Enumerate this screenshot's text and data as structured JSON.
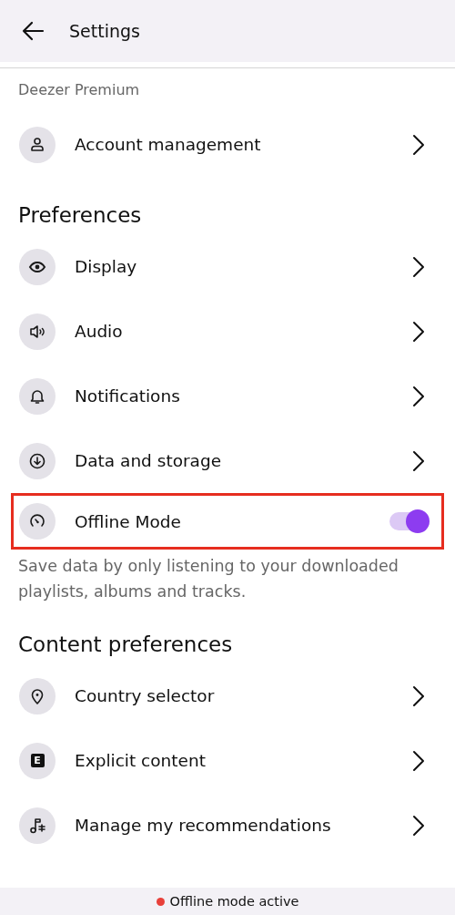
{
  "header": {
    "title": "Settings"
  },
  "sections": [
    {
      "kind": "caption",
      "title": "Deezer Premium",
      "items": [
        {
          "kind": "link",
          "label": "Account management"
        }
      ]
    },
    {
      "kind": "heading",
      "title": "Preferences",
      "items": [
        {
          "kind": "link",
          "label": "Display"
        },
        {
          "kind": "link",
          "label": "Audio"
        },
        {
          "kind": "link",
          "label": "Notifications"
        },
        {
          "kind": "link",
          "label": "Data and storage"
        },
        {
          "kind": "toggle",
          "label": "Offline Mode",
          "on": true,
          "highlighted": true,
          "description": "Save data by only listening to your downloaded playlists, albums and tracks."
        }
      ]
    },
    {
      "kind": "heading",
      "title": "Content preferences",
      "items": [
        {
          "kind": "link",
          "label": "Country selector"
        },
        {
          "kind": "link",
          "icon_text": "E",
          "label": "Explicit content"
        },
        {
          "kind": "link",
          "label": "Manage my recommendations"
        }
      ]
    }
  ],
  "status_banner": {
    "text": "Offline mode active",
    "color": "#e8403a"
  }
}
